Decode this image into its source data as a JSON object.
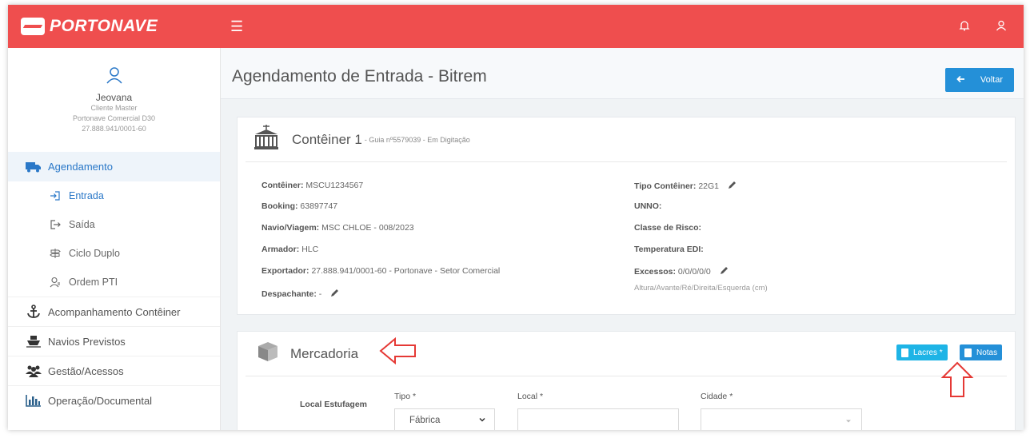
{
  "app": {
    "logo_text": "PORTONAVE"
  },
  "user": {
    "name": "Jeovana",
    "role": "Cliente Master",
    "company": "Portonave Comercial D30",
    "document": "27.888.941/0001-60"
  },
  "sidebar": {
    "items": [
      {
        "label": "Agendamento",
        "icon": "truck-icon"
      },
      {
        "label": "Entrada",
        "icon": "login-icon"
      },
      {
        "label": "Saída",
        "icon": "logout-icon"
      },
      {
        "label": "Ciclo Duplo",
        "icon": "signpost-icon"
      },
      {
        "label": "Ordem PTI",
        "icon": "user-card-icon"
      },
      {
        "label": "Acompanhamento Contêiner",
        "icon": "anchor-icon"
      },
      {
        "label": "Navios Previstos",
        "icon": "ship-icon"
      },
      {
        "label": "Gestão/Acessos",
        "icon": "users-icon"
      },
      {
        "label": "Operação/Documental",
        "icon": "bar-chart-icon"
      }
    ]
  },
  "header": {
    "title": "Agendamento de Entrada - Bitrem",
    "back_label": "Voltar"
  },
  "container_card": {
    "title": "Contêiner 1",
    "subtitle": "- Guia nº5579039 - Em Digitação",
    "left": [
      {
        "label": "Contêiner:",
        "value": "MSCU1234567"
      },
      {
        "label": "Booking:",
        "value": "63897747"
      },
      {
        "label": "Navio/Viagem:",
        "value": "MSC CHLOE - 008/2023"
      },
      {
        "label": "Armador:",
        "value": "HLC"
      },
      {
        "label": "Exportador:",
        "value": "27.888.941/0001-60 - Portonave - Setor Comercial"
      },
      {
        "label": "Despachante:",
        "value": "-"
      }
    ],
    "right": [
      {
        "label": "Tipo Contêiner:",
        "value": "22G1"
      },
      {
        "label": "UNNO:",
        "value": ""
      },
      {
        "label": "Classe de Risco:",
        "value": ""
      },
      {
        "label": "Temperatura EDI:",
        "value": ""
      },
      {
        "label": "Excessos:",
        "value": "0/0/0/0/0"
      }
    ],
    "excessos_hint": "Altura/Avante/Ré/Direita/Esquerda (cm)"
  },
  "mercadoria_card": {
    "title": "Mercadoria",
    "lacres_label": "Lacres *",
    "notas_label": "Notas",
    "local_estufagem_label": "Local Estufagem",
    "tipo_label": "Tipo *",
    "tipo_value": "Fábrica",
    "local_label": "Local *",
    "local_value": "",
    "cidade_label": "Cidade *",
    "cidade_value": ""
  },
  "colors": {
    "topbar": "#ef4e4e",
    "accent": "#2490d8",
    "button_light": "#1eb4e6",
    "annotation_arrow": "#e53935"
  }
}
